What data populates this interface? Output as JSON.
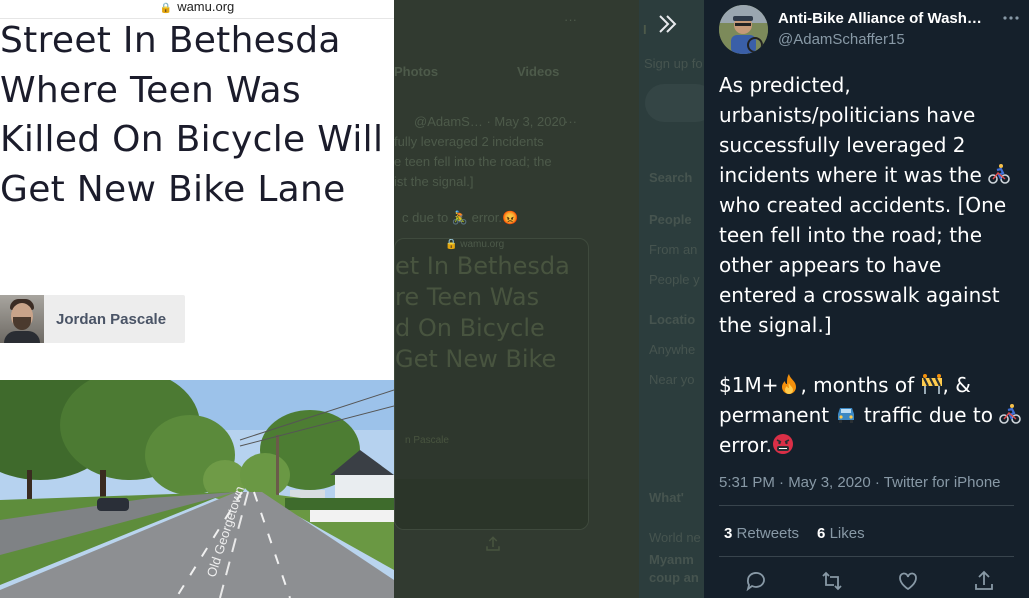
{
  "article": {
    "domain": "wamu.org",
    "headline": "Street In Bethesda Where Teen Was Killed On Bicycle Will Get New Bike Lane",
    "author": "Jordan Pascale",
    "photo_street_sign": "Old Georgetown"
  },
  "backdrop": {
    "tab_photos": "Photos",
    "tab_videos": "Videos",
    "meta": "@AdamS…  ·  May 3, 2020",
    "line1": "fully leveraged 2 incidents",
    "line2": "e teen fell into the road; the",
    "line3": "ist the signal.]",
    "line4": "c due to 🚴 error.😡",
    "card_domain": "🔒 wamu.org",
    "card_headline": "et In Bethesda\nre Teen Was\nd On Bicycle\nGet New Bike",
    "card_author": "n Pascale",
    "right_letter": "I",
    "sign_up": "Sign up fo",
    "search": "Search",
    "people": "People",
    "from_anyone": "From an",
    "people_you": "People y",
    "location": "Locatio",
    "anywhere": "Anywhe",
    "near_you": "Near yo",
    "whats": "What'",
    "world": "World ne",
    "myanmar": "Myanm",
    "coup": "coup an"
  },
  "tweet": {
    "display_name": "Anti-Bike Alliance of Wash…",
    "handle": "@AdamSchaffer15",
    "text_part1": "As predicted, urbanists/politicians have successfully leveraged 2 incidents where it was the ",
    "text_part2": " who created accidents. [One teen fell into the road; the other appears to have entered a crosswalk against the signal.]\n\n$1M+",
    "text_part3": ", months of ",
    "text_part4": ", & permanent ",
    "text_part5": " traffic due to ",
    "text_part6": " error.",
    "timestamp": "5:31 PM · May 3, 2020 · Twitter for iPhone",
    "retweets_count": "3",
    "retweets_label": "Retweets",
    "likes_count": "6",
    "likes_label": "Likes",
    "icons": [
      "bicyclist-emoji",
      "fire-emoji",
      "construction-barrier-emoji",
      "car-emoji",
      "angry-face-emoji",
      "reply-icon",
      "retweet-icon",
      "like-icon",
      "share-icon",
      "more-icon",
      "chevron-right-icon"
    ]
  },
  "colors": {
    "tweet_bg": "#15202b",
    "secondary_text": "#8899a6",
    "headline_text": "#1b1c2b",
    "backdrop": "#313a30"
  }
}
